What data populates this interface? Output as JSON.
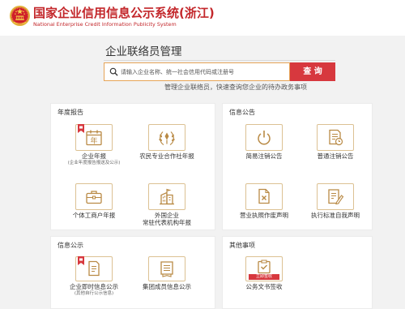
{
  "header": {
    "title": "国家企业信用信息公示系统(浙江)",
    "subtitle": "National Enterprise Credit Information Publicity System",
    "emblem_icon": "national-emblem-icon"
  },
  "liaison": {
    "heading": "企业联络员管理",
    "search_icon": "search-icon",
    "search_placeholder": "请输入企业名称、统一社会信用代码或注册号",
    "search_button": "查 询",
    "hint": "管理企业联络员，快速查询您企业的待办政务事项"
  },
  "panels": {
    "annual_report": {
      "title": "年度报告",
      "items": [
        {
          "label": "企业年报",
          "sub": "(企业年度报告报送及公示)",
          "icon": "calendar-year-icon",
          "icon_glyph": "年",
          "tagged": true
        },
        {
          "label": "农民专业合作社年报",
          "icon": "wheat-emblem-icon"
        },
        {
          "label": "个体工商户年报",
          "icon": "briefcase-icon"
        },
        {
          "label": "外国企业",
          "label_line2": "常驻代表机构年报",
          "icon": "building-icon"
        }
      ]
    },
    "notices": {
      "title": "信息公告",
      "items": [
        {
          "label": "简易注销公告",
          "icon": "power-icon"
        },
        {
          "label": "普通注销公告",
          "icon": "document-clock-icon"
        },
        {
          "label": "营业执照作废声明",
          "icon": "document-cancel-icon"
        },
        {
          "label": "执行标准自我声明",
          "icon": "document-pen-icon"
        }
      ]
    },
    "publicity": {
      "title": "信息公示",
      "items": [
        {
          "label": "企业即时信息公示",
          "sub": "(其他自行公示信息)",
          "icon": "document-lines-icon",
          "tagged": true
        },
        {
          "label": "集团成员信息公示",
          "icon": "binder-icon"
        }
      ]
    },
    "other": {
      "title": "其他事项",
      "items": [
        {
          "label": "公务文书签收",
          "icon": "clipboard-check-icon",
          "badge": "立即签收"
        }
      ]
    }
  },
  "colors": {
    "brand_red": "#c3272b",
    "button_red": "#d7383e",
    "icon_gold": "#b98a45",
    "icon_border": "#dcc193",
    "search_border": "#e6a457",
    "page_background": "#f2f2f2"
  }
}
